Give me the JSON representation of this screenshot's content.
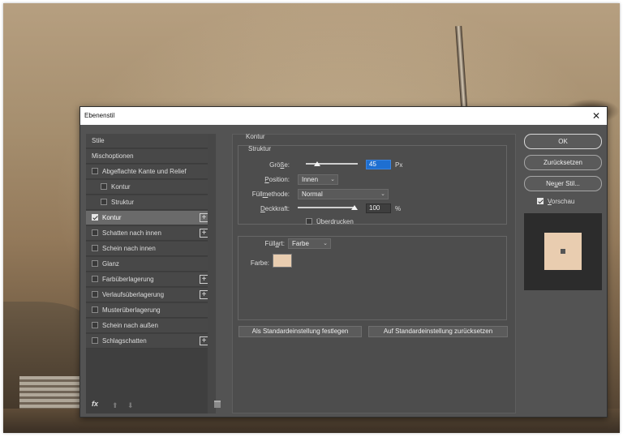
{
  "window": {
    "title": "Ebenenstil",
    "close_label": "✕"
  },
  "sidebar": {
    "items": [
      {
        "label": "Stile",
        "has_checkbox": false,
        "checked": false,
        "sub": false,
        "plus": false
      },
      {
        "label": "Mischoptionen",
        "has_checkbox": false,
        "checked": false,
        "sub": false,
        "plus": false
      },
      {
        "label": "Abgeflachte Kante und Relief",
        "has_checkbox": true,
        "checked": false,
        "sub": false,
        "plus": false
      },
      {
        "label": "Kontur",
        "has_checkbox": true,
        "checked": false,
        "sub": true,
        "plus": false
      },
      {
        "label": "Struktur",
        "has_checkbox": true,
        "checked": false,
        "sub": true,
        "plus": false
      },
      {
        "label": "Kontur",
        "has_checkbox": true,
        "checked": true,
        "sub": false,
        "plus": true,
        "selected": true
      },
      {
        "label": "Schatten nach innen",
        "has_checkbox": true,
        "checked": false,
        "sub": false,
        "plus": true
      },
      {
        "label": "Schein nach innen",
        "has_checkbox": true,
        "checked": false,
        "sub": false,
        "plus": false
      },
      {
        "label": "Glanz",
        "has_checkbox": true,
        "checked": false,
        "sub": false,
        "plus": false
      },
      {
        "label": "Farbüberlagerung",
        "has_checkbox": true,
        "checked": false,
        "sub": false,
        "plus": true
      },
      {
        "label": "Verlaufsüberlagerung",
        "has_checkbox": true,
        "checked": false,
        "sub": false,
        "plus": true
      },
      {
        "label": "Musterüberlagerung",
        "has_checkbox": true,
        "checked": false,
        "sub": false,
        "plus": false
      },
      {
        "label": "Schein nach außen",
        "has_checkbox": true,
        "checked": false,
        "sub": false,
        "plus": false
      },
      {
        "label": "Schlagschatten",
        "has_checkbox": true,
        "checked": false,
        "sub": false,
        "plus": true
      }
    ],
    "footer": {
      "fx_label": "fx",
      "move_up_icon": "arrow-up-icon",
      "move_down_icon": "arrow-down-icon",
      "delete_icon": "trash-icon"
    }
  },
  "main": {
    "section_title": "Kontur",
    "structure": {
      "title": "Struktur",
      "size_label_prefix": "Grö",
      "size_label_u": "ß",
      "size_label_suffix": "e:",
      "size_value": "45",
      "size_unit": "Px",
      "size_slider_fraction": 0.22,
      "position_label_u": "P",
      "position_label_rest": "osition:",
      "position_value": "Innen",
      "blend_label_prefix": "Füll",
      "blend_label_u": "m",
      "blend_label_suffix": "ethode:",
      "blend_value": "Normal",
      "opacity_label_u": "D",
      "opacity_label_rest": "eckkraft:",
      "opacity_value": "100",
      "opacity_unit": "%",
      "opacity_slider_fraction": 1.0,
      "overprint_label": "Überdrucken"
    },
    "fill": {
      "type_label_prefix": "Füll",
      "type_label_u": "a",
      "type_label_suffix": "rt:",
      "type_value": "Farbe",
      "color_label": "Farbe:",
      "color": "#e9cdb0"
    },
    "buttons": {
      "set_default": "Als Standardeinstellung festlegen",
      "reset_default": "Auf Standardeinstellung zurücksetzen"
    }
  },
  "right": {
    "ok": "OK",
    "reset": "Zurücksetzen",
    "new_style_prefix": "Ne",
    "new_style_u": "u",
    "new_style_suffix": "er Stil...",
    "preview_label_u": "V",
    "preview_label_rest": "orschau",
    "preview_checked": true
  },
  "colors": {
    "dialog_bg": "#535353",
    "focus_blue": "#1e6fd1",
    "stroke_color": "#e9cdb0"
  }
}
